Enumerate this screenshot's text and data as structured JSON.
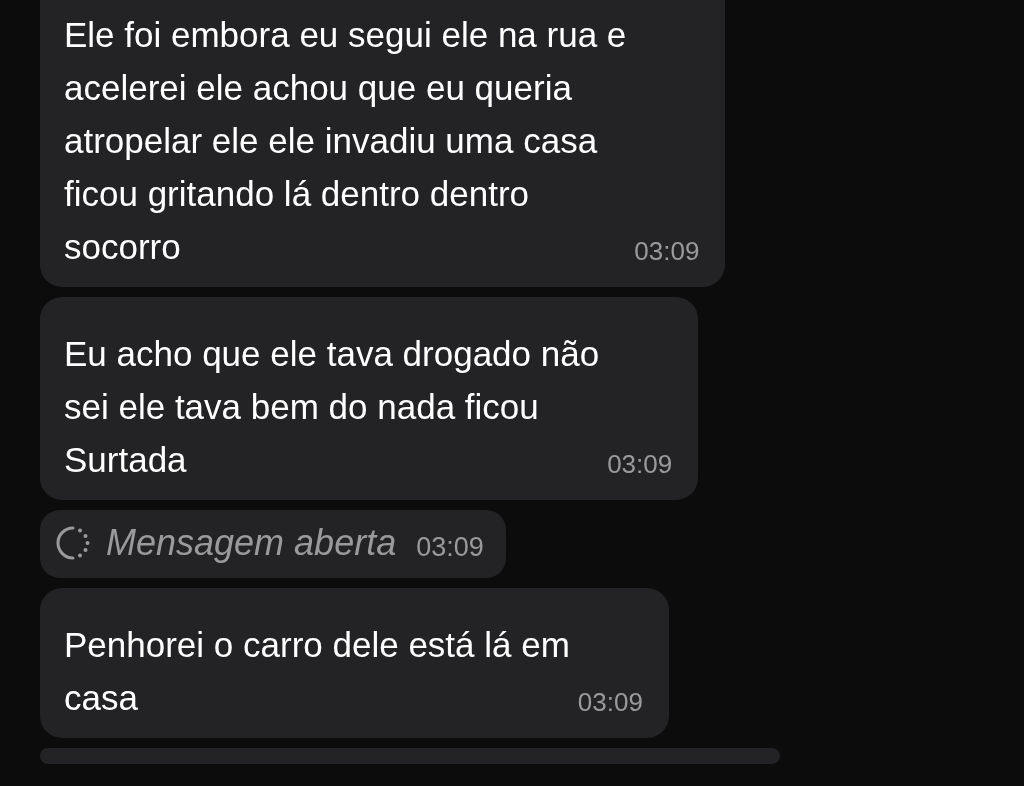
{
  "messages": [
    {
      "kind": "text",
      "text": "Ele foi embora eu segui ele na rua e\nacelerei ele achou que eu queria\natropelar ele ele invadiu uma casa\nficou gritando lá dentro dentro\nsocorro",
      "time": "03:09"
    },
    {
      "kind": "text",
      "text": "Eu acho que ele tava drogado não\nsei ele tava bem do nada ficou\nSurtada",
      "time": "03:09"
    },
    {
      "kind": "opened",
      "text": "Mensagem aberta",
      "time": "03:09"
    },
    {
      "kind": "text",
      "text": "Penhorei o carro dele está lá em\ncasa",
      "time": "03:09"
    }
  ]
}
